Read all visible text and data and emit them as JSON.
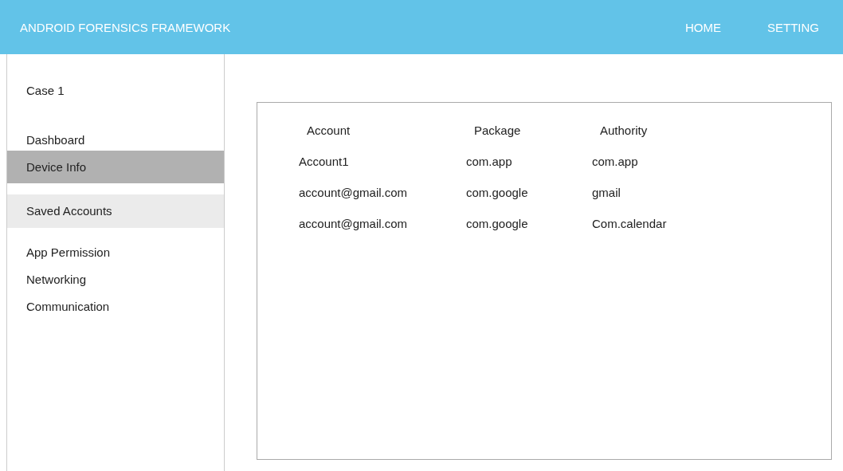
{
  "header": {
    "title": "ANDROID FORENSICS FRAMEWORK",
    "nav": [
      {
        "label": "HOME"
      },
      {
        "label": "SETTING"
      }
    ]
  },
  "sidebar": {
    "case_title": "Case 1",
    "items": [
      {
        "label": "Dashboard",
        "selected": false,
        "highlighted": false
      },
      {
        "label": "Device Info",
        "selected": true,
        "highlighted": false
      },
      {
        "label": "Saved Accounts",
        "selected": false,
        "highlighted": true
      },
      {
        "label": "App Permission",
        "selected": false,
        "highlighted": false
      },
      {
        "label": "Networking",
        "selected": false,
        "highlighted": false
      },
      {
        "label": "Communication",
        "selected": false,
        "highlighted": false
      }
    ]
  },
  "table": {
    "columns": [
      "Account",
      "Package",
      "Authority"
    ],
    "rows": [
      [
        "Account1",
        "com.app",
        "com.app"
      ],
      [
        "account@gmail.com",
        "com.google",
        "gmail"
      ],
      [
        "account@gmail.com",
        "com.google",
        "Com.calendar"
      ]
    ]
  }
}
